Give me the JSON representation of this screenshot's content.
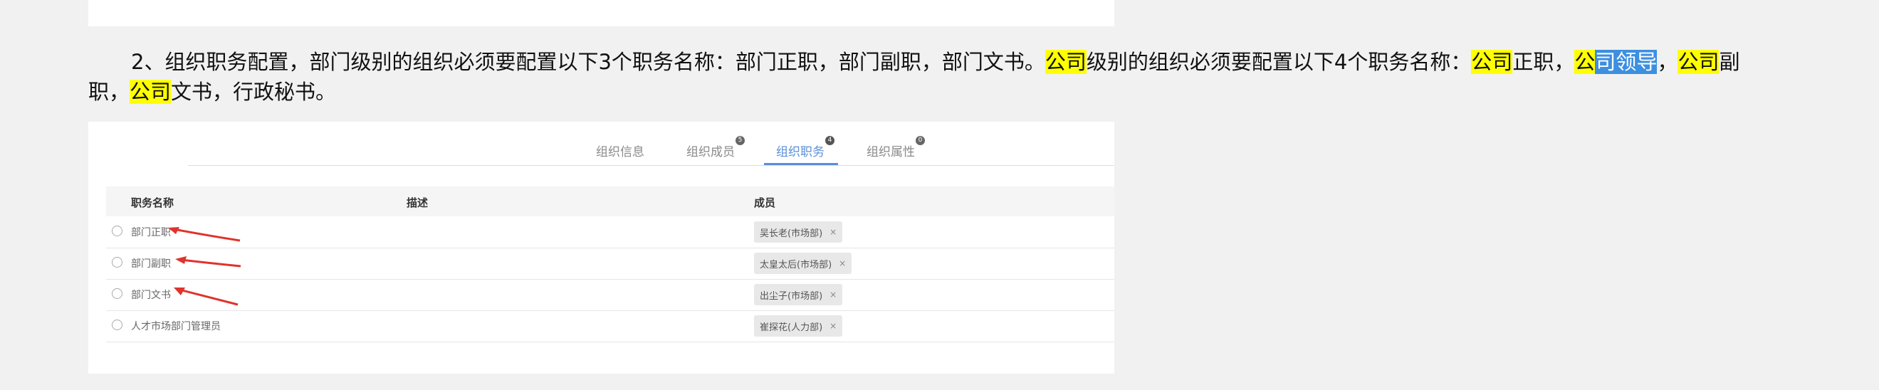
{
  "paragraph": {
    "segments": [
      {
        "text": "2、组织职务配置，部门级别的组织必须要配置以下3个职务名称：部门正职，部门副职，部门文书。",
        "style": "normal"
      },
      {
        "text": "公司",
        "style": "yellow"
      },
      {
        "text": "级别的组织必须要配置以下4个职务名称：",
        "style": "normal"
      },
      {
        "text": "公司",
        "style": "yellow"
      },
      {
        "text": "正职，",
        "style": "normal"
      },
      {
        "text": "公",
        "style": "yellow"
      },
      {
        "text": "司领导",
        "style": "blue"
      },
      {
        "text": "，",
        "style": "normal"
      },
      {
        "text": "公司",
        "style": "yellow"
      },
      {
        "text": "副职，",
        "style": "normal"
      },
      {
        "text": "公司",
        "style": "yellow"
      },
      {
        "text": "文书，行政秘书。",
        "style": "normal"
      }
    ]
  },
  "tabs": [
    {
      "label": "组织信息",
      "badge": ""
    },
    {
      "label": "组织成员",
      "badge": "5"
    },
    {
      "label": "组织职务",
      "badge": "4",
      "active": true
    },
    {
      "label": "组织属性",
      "badge": "0"
    }
  ],
  "table": {
    "headers": {
      "name": "职务名称",
      "desc": "描述",
      "members": "成员"
    },
    "rows": [
      {
        "name": "部门正职",
        "member": "吴长老(市场部)"
      },
      {
        "name": "部门副职",
        "member": "太皇太后(市场部)"
      },
      {
        "name": "部门文书",
        "member": "出尘子(市场部)"
      },
      {
        "name": "人才市场部门管理员",
        "member": "崔探花(人力部)"
      }
    ],
    "remove_glyph": "×"
  },
  "colors": {
    "highlight_yellow": "#ffff00",
    "highlight_blue": "#3d8fe0",
    "tab_active": "#5b8fd6",
    "arrow": "#e0332c"
  }
}
